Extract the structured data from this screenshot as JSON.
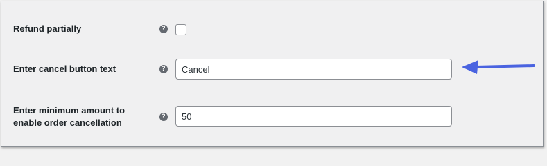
{
  "settings": {
    "refund_partially": {
      "label": "Refund partially",
      "checked": false
    },
    "cancel_button_text": {
      "label": "Enter cancel button text",
      "value": "Cancel"
    },
    "minimum_amount": {
      "label_line1": "Enter minimum amount to",
      "label_line2": "enable order cancellation",
      "value": "50"
    },
    "help_glyph": "?"
  },
  "colors": {
    "arrow": "#4a63e0",
    "help_icon": "#646970"
  }
}
